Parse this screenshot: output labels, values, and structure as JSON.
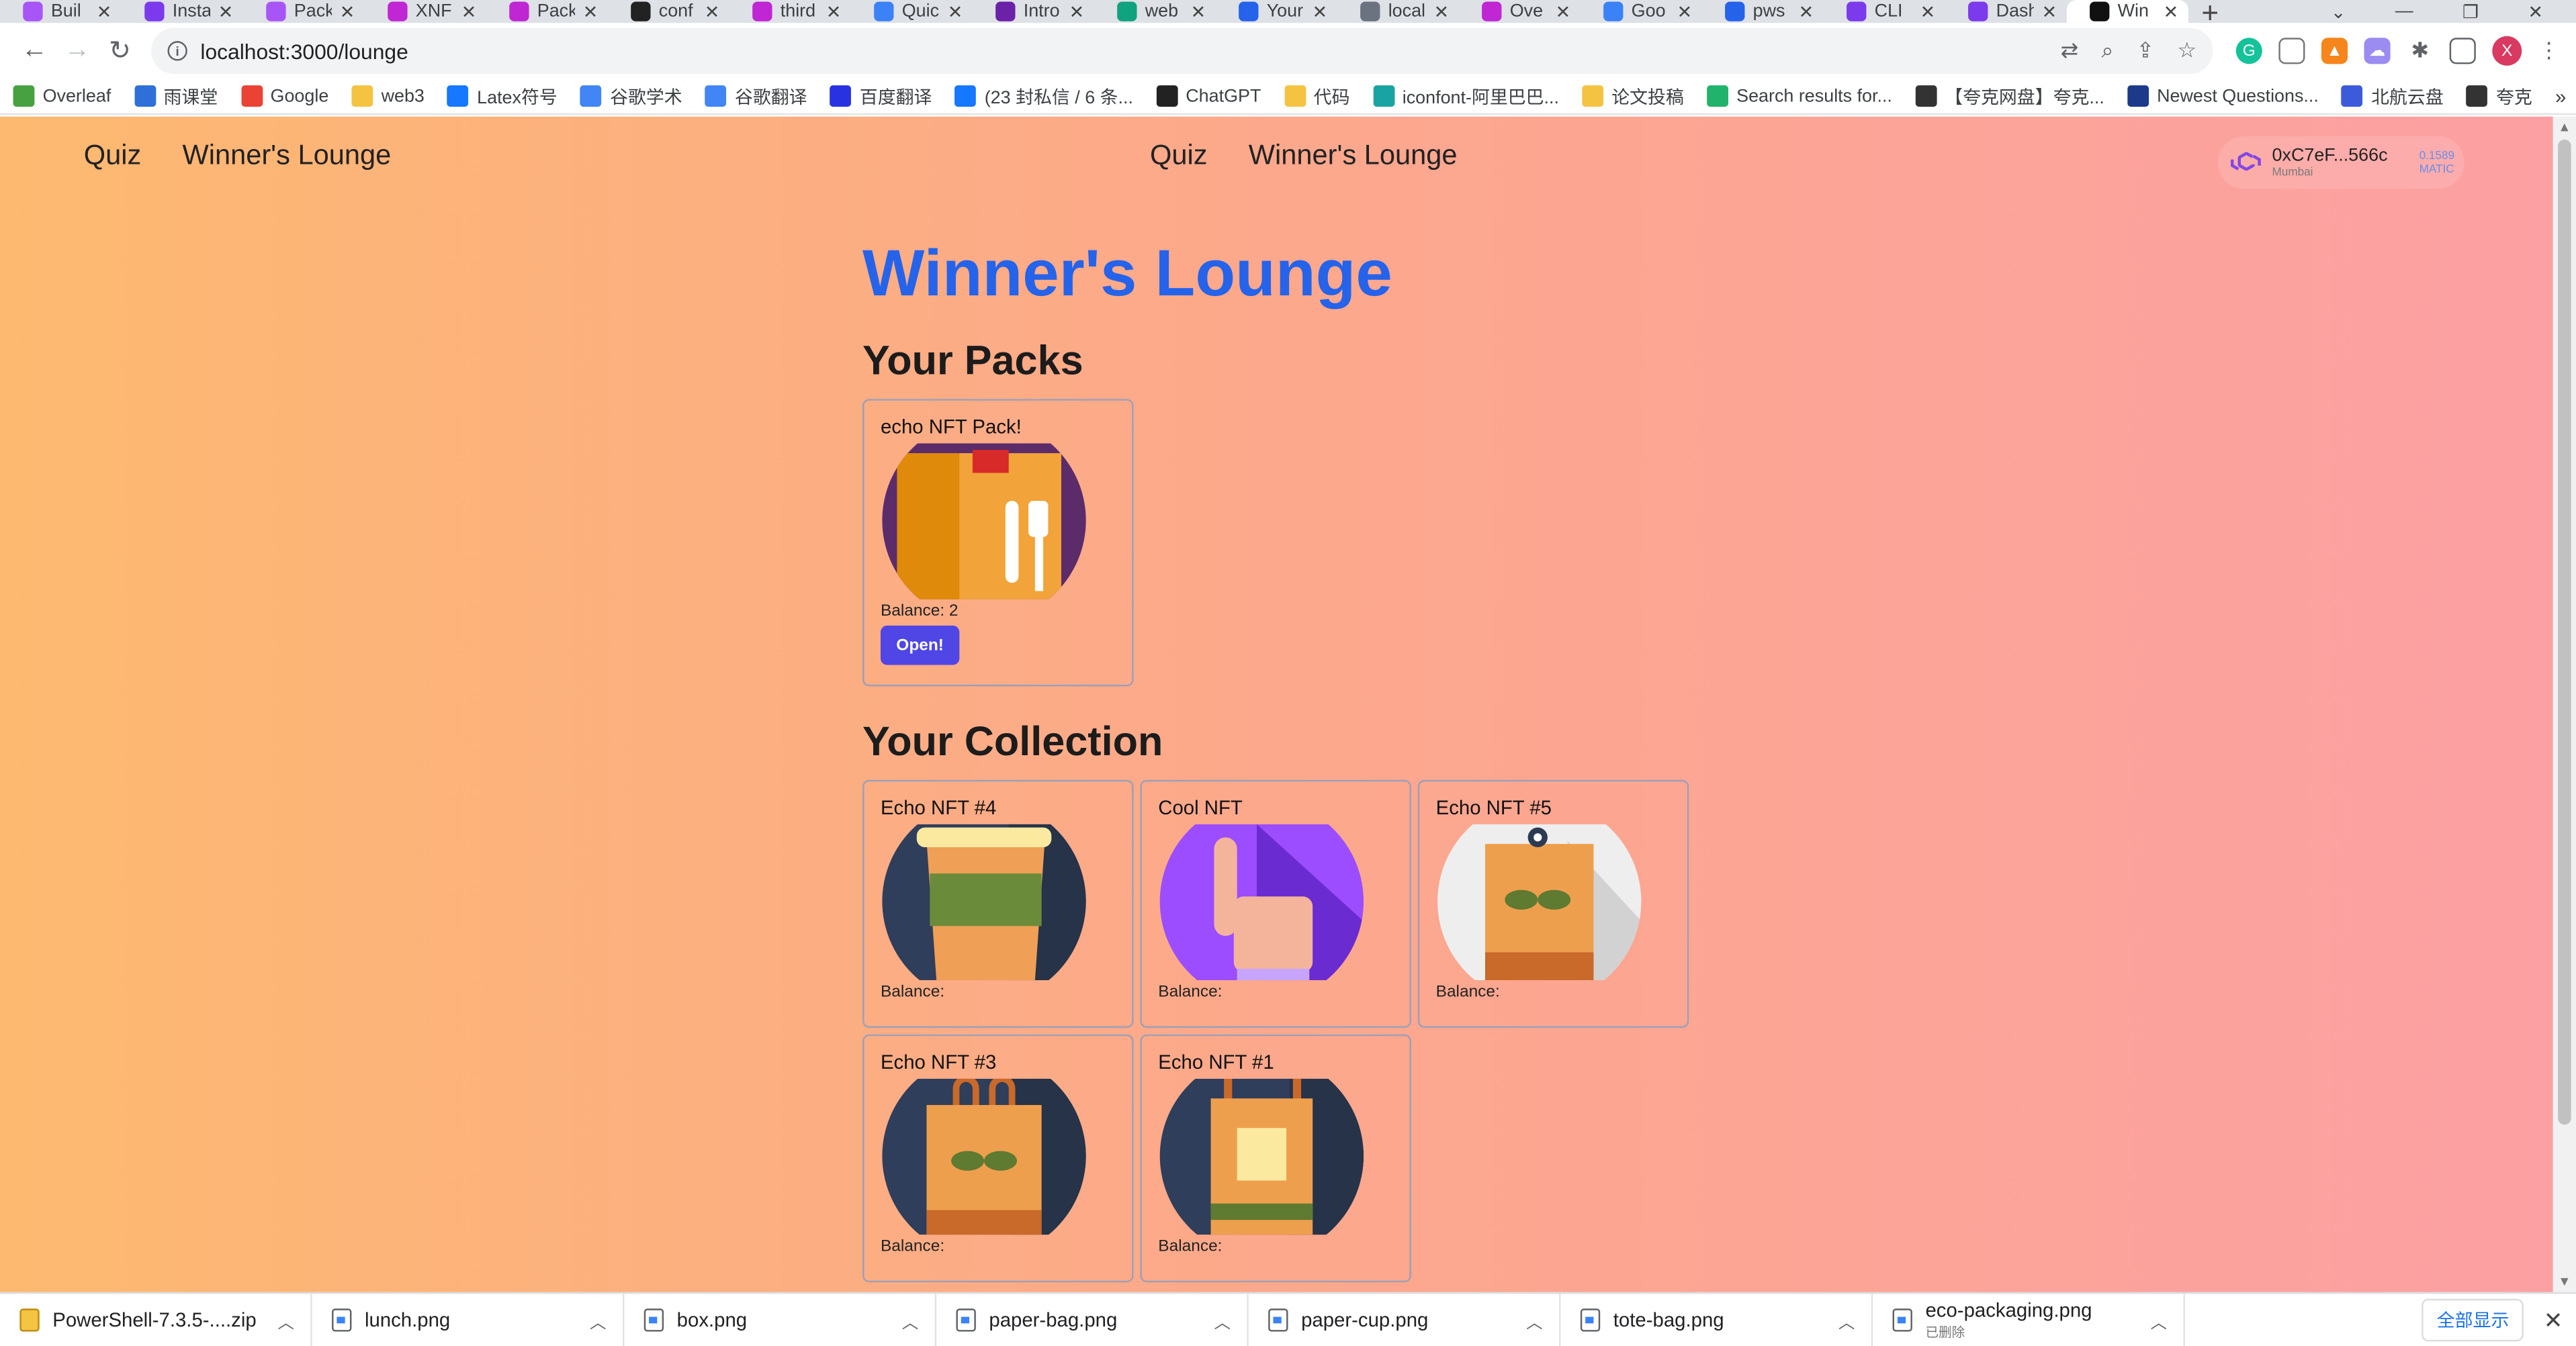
{
  "browser": {
    "tabs": [
      {
        "title": "Buil",
        "color": "#a855f7"
      },
      {
        "title": "Insta",
        "color": "#7c3aed"
      },
      {
        "title": "Pack",
        "color": "#a855f7"
      },
      {
        "title": "XNF",
        "color": "#c026d3"
      },
      {
        "title": "Pack",
        "color": "#c026d3"
      },
      {
        "title": "conf",
        "color": "#222222"
      },
      {
        "title": "third",
        "color": "#c026d3"
      },
      {
        "title": "Quic",
        "color": "#3b82f6"
      },
      {
        "title": "Intro",
        "color": "#6b21a8"
      },
      {
        "title": "web",
        "color": "#10a37f"
      },
      {
        "title": "Your",
        "color": "#2563eb"
      },
      {
        "title": "local",
        "color": "#6b7280"
      },
      {
        "title": "Ove",
        "color": "#c026d3"
      },
      {
        "title": "Goo",
        "color": "#3b82f6"
      },
      {
        "title": "pws",
        "color": "#2563eb"
      },
      {
        "title": "CLI",
        "color": "#7c3aed"
      },
      {
        "title": "Dash",
        "color": "#7c3aed"
      },
      {
        "title": "Win",
        "color": "#111111"
      }
    ],
    "url": "localhost:3000/lounge",
    "bookmarks": [
      {
        "label": "Overleaf",
        "color": "#47a141"
      },
      {
        "label": "雨课堂",
        "color": "#2f6fd8"
      },
      {
        "label": "Google",
        "color": "#ea4335"
      },
      {
        "label": "web3",
        "color": "#f5c342"
      },
      {
        "label": "Latex符号",
        "color": "#1677ff"
      },
      {
        "label": "谷歌学术",
        "color": "#4285f4"
      },
      {
        "label": "谷歌翻译",
        "color": "#4285f4"
      },
      {
        "label": "百度翻译",
        "color": "#2932e1"
      },
      {
        "label": "(23 封私信 / 6 条...",
        "color": "#1677ff"
      },
      {
        "label": "ChatGPT",
        "color": "#222222"
      },
      {
        "label": "代码",
        "color": "#f5c342"
      },
      {
        "label": "iconfont-阿里巴巴...",
        "color": "#1aa3a3"
      },
      {
        "label": "论文投稿",
        "color": "#f5c342"
      },
      {
        "label": "Search results for...",
        "color": "#21b36b"
      },
      {
        "label": "【夸克网盘】夸克...",
        "color": "#333333"
      },
      {
        "label": "Newest Questions...",
        "color": "#1d3a8a"
      },
      {
        "label": "北航云盘",
        "color": "#3b5bdb"
      },
      {
        "label": "夸克",
        "color": "#333333"
      }
    ],
    "profile_initial": "X"
  },
  "nav": {
    "left_quiz": "Quiz",
    "left_lounge": "Winner's Lounge",
    "center_quiz": "Quiz",
    "center_lounge": "Winner's Lounge"
  },
  "wallet": {
    "address": "0xC7eF...566c",
    "network": "Mumbai",
    "balance": "0.1589",
    "unit": "MATIC"
  },
  "page": {
    "title": "Winner's Lounge",
    "packs_heading": "Your Packs",
    "collection_heading": "Your Collection"
  },
  "packs": [
    {
      "name": "echo NFT Pack!",
      "balance": "Balance: 2",
      "open_label": "Open!"
    }
  ],
  "collection": [
    {
      "name": "Echo NFT #4",
      "balance": "Balance:",
      "art": "paper-cup"
    },
    {
      "name": "Cool NFT",
      "balance": "Balance:",
      "art": "hand"
    },
    {
      "name": "Echo NFT #5",
      "balance": "Balance:",
      "art": "eco-packaging"
    },
    {
      "name": "Echo NFT #3",
      "balance": "Balance:",
      "art": "tote-bag"
    },
    {
      "name": "Echo NFT #1",
      "balance": "Balance:",
      "art": "paper-bag"
    }
  ],
  "downloads": [
    {
      "file": "PowerShell-7.3.5-....zip",
      "type": "zip"
    },
    {
      "file": "lunch.png",
      "type": "png"
    },
    {
      "file": "box.png",
      "type": "png"
    },
    {
      "file": "paper-bag.png",
      "type": "png"
    },
    {
      "file": "paper-cup.png",
      "type": "png"
    },
    {
      "file": "tote-bag.png",
      "type": "png"
    },
    {
      "file": "eco-packaging.png",
      "type": "png",
      "status": "已删除"
    }
  ],
  "downloads_show_all": "全部显示"
}
